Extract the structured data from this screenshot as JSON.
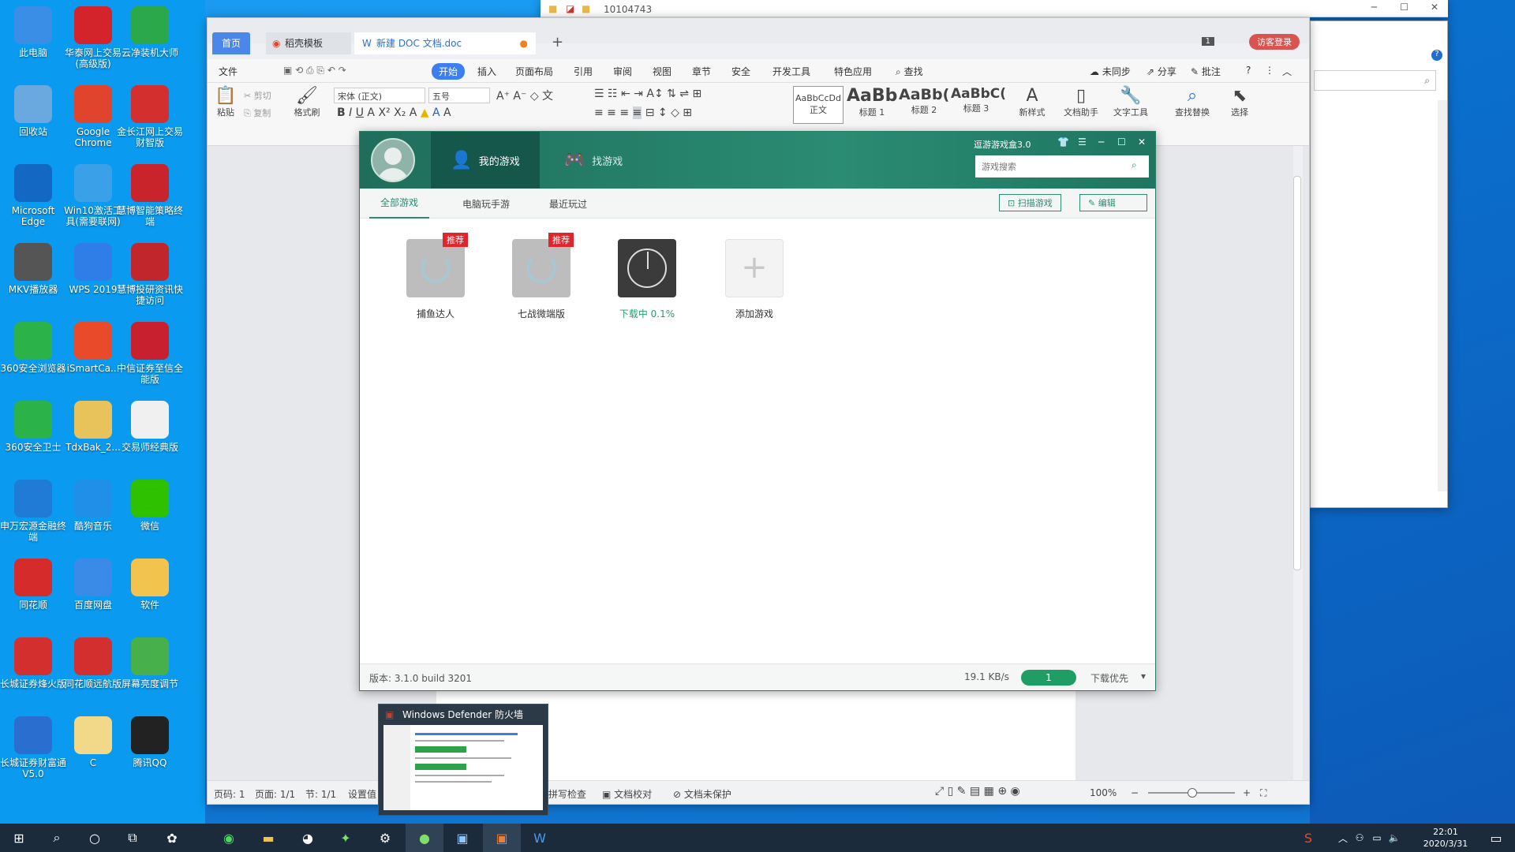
{
  "desktop": {
    "icons": [
      {
        "label": "此电脑",
        "icon": "computer-icon",
        "color": "#3a8ee6"
      },
      {
        "label": "华泰网上交易(高级版)",
        "icon": "huatai-icon",
        "color": "#d3242c"
      },
      {
        "label": "云净装机大师",
        "icon": "shield-icon",
        "color": "#2aa84a"
      },
      {
        "label": "回收站",
        "icon": "recycle-bin-icon",
        "color": "#6aa9e0"
      },
      {
        "label": "Google Chrome",
        "icon": "chrome-icon",
        "color": "#e0442c"
      },
      {
        "label": "金长江网上交易财智版",
        "icon": "changjiang-icon",
        "color": "#d32f2f"
      },
      {
        "label": "Microsoft Edge",
        "icon": "edge-icon",
        "color": "#1368c4"
      },
      {
        "label": "Win10激活工具(需要联网)",
        "icon": "windows-icon",
        "color": "#3aa0e8"
      },
      {
        "label": "慧博智能策略终端",
        "icon": "huibo-icon",
        "color": "#c9242b"
      },
      {
        "label": "MKV播放器",
        "icon": "player-icon",
        "color": "#555"
      },
      {
        "label": "WPS 2019",
        "icon": "wps-icon",
        "color": "#2f7ee8"
      },
      {
        "label": "慧博投研资讯快捷访问",
        "icon": "huibo2-icon",
        "color": "#c0262b"
      },
      {
        "label": "360安全浏览器",
        "icon": "browser360-icon",
        "color": "#2bb34a"
      },
      {
        "label": "iSmartCa...",
        "icon": "ismart-icon",
        "color": "#e94b2a"
      },
      {
        "label": "中信证券至信全能版",
        "icon": "citic-icon",
        "color": "#c8202f"
      },
      {
        "label": "360安全卫士",
        "icon": "guard360-icon",
        "color": "#2bb34a"
      },
      {
        "label": "TdxBak_2...",
        "icon": "folder-icon",
        "color": "#e8c25a"
      },
      {
        "label": "交易师经典版",
        "icon": "kt-icon",
        "color": "#f0f0f0"
      },
      {
        "label": "申万宏源金融终端",
        "icon": "swhy-icon",
        "color": "#1f7bd6"
      },
      {
        "label": "酷狗音乐",
        "icon": "kugou-icon",
        "color": "#1f8fe8"
      },
      {
        "label": "微信",
        "icon": "wechat-icon",
        "color": "#2dc100"
      },
      {
        "label": "同花顺",
        "icon": "tonghuashun-icon",
        "color": "#d52b2b"
      },
      {
        "label": "百度网盘",
        "icon": "baidu-icon",
        "color": "#3a8be8"
      },
      {
        "label": "软件",
        "icon": "folder-icon",
        "color": "#f2c44e"
      },
      {
        "label": "长城证券烽火版",
        "icon": "gw-icon",
        "color": "#d32f2f"
      },
      {
        "label": "同花顺远航版",
        "icon": "ths-icon",
        "color": "#d32f2f"
      },
      {
        "label": "屏幕亮度调节",
        "icon": "brightness-icon",
        "color": "#48b04a"
      },
      {
        "label": "长城证券财富通V5.0",
        "icon": "gw2-icon",
        "color": "#2a6fd0"
      },
      {
        "label": "C",
        "icon": "folder-icon",
        "color": "#f2d98a"
      },
      {
        "label": "腾讯QQ",
        "icon": "qq-icon",
        "color": "#222"
      }
    ]
  },
  "explorer": {
    "title": "10104743"
  },
  "wps": {
    "tabs": {
      "home": "首页",
      "template": "稻壳模板",
      "doc": "新建 DOC 文档.doc",
      "page_num": "1",
      "login": "访客登录"
    },
    "menu": {
      "file": "文件",
      "start": "开始",
      "insert": "插入",
      "layout": "页面布局",
      "ref": "引用",
      "review": "审阅",
      "view": "视图",
      "chapter": "章节",
      "security": "安全",
      "dev": "开发工具",
      "special": "特色应用",
      "search": "查找",
      "sync": "未同步",
      "share": "分享",
      "comment": "批注"
    },
    "toolbar": {
      "paste": "粘贴",
      "cut": "剪切",
      "copy": "复制",
      "format_painter": "格式刷",
      "font": "宋体 (正文)",
      "size": "五号",
      "style_normal_preview": "AaBbCcDd",
      "style_normal": "正文",
      "style_h1_preview": "AaBb",
      "style_h1": "标题 1",
      "style_h2_preview": "AaBb(",
      "style_h2": "标题 2",
      "style_h3_preview": "AaBbC(",
      "style_h3": "标题 3",
      "new_style": "新样式",
      "doc_helper": "文档助手",
      "text_tool": "文字工具",
      "find_replace": "查找替换",
      "select": "选择"
    },
    "status": {
      "page": "页码: 1",
      "pages": "页面: 1/1",
      "section": "节: 1/1",
      "settings": "设置值",
      "spell": "拼写检查",
      "proof": "文档校对",
      "protect": "文档未保护",
      "zoom": "100%"
    }
  },
  "game": {
    "title": "逗游游戏盒3.0",
    "nav": {
      "my_games": "我的游戏",
      "find_games": "找游戏"
    },
    "search_placeholder": "游戏搜索",
    "subtabs": {
      "all": "全部游戏",
      "mobile": "电脑玩手游",
      "recent": "最近玩过"
    },
    "scan_button": "扫描游戏",
    "edit_button": "编辑",
    "games": [
      {
        "name": "捕鱼达人",
        "badge": "推荐"
      },
      {
        "name": "七战微端版",
        "badge": "推荐"
      },
      {
        "name": "下载中 0.1%",
        "badge": ""
      },
      {
        "name": "添加游戏",
        "badge": ""
      }
    ],
    "footer": {
      "version": "版本: 3.1.0 build 3201",
      "speed": "19.1 KB/s",
      "count": "1",
      "priority": "下载优先"
    }
  },
  "thumbnail": {
    "title": "Windows Defender 防火墙"
  },
  "taskbar": {
    "time": "22:01",
    "date": "2020/3/31"
  }
}
